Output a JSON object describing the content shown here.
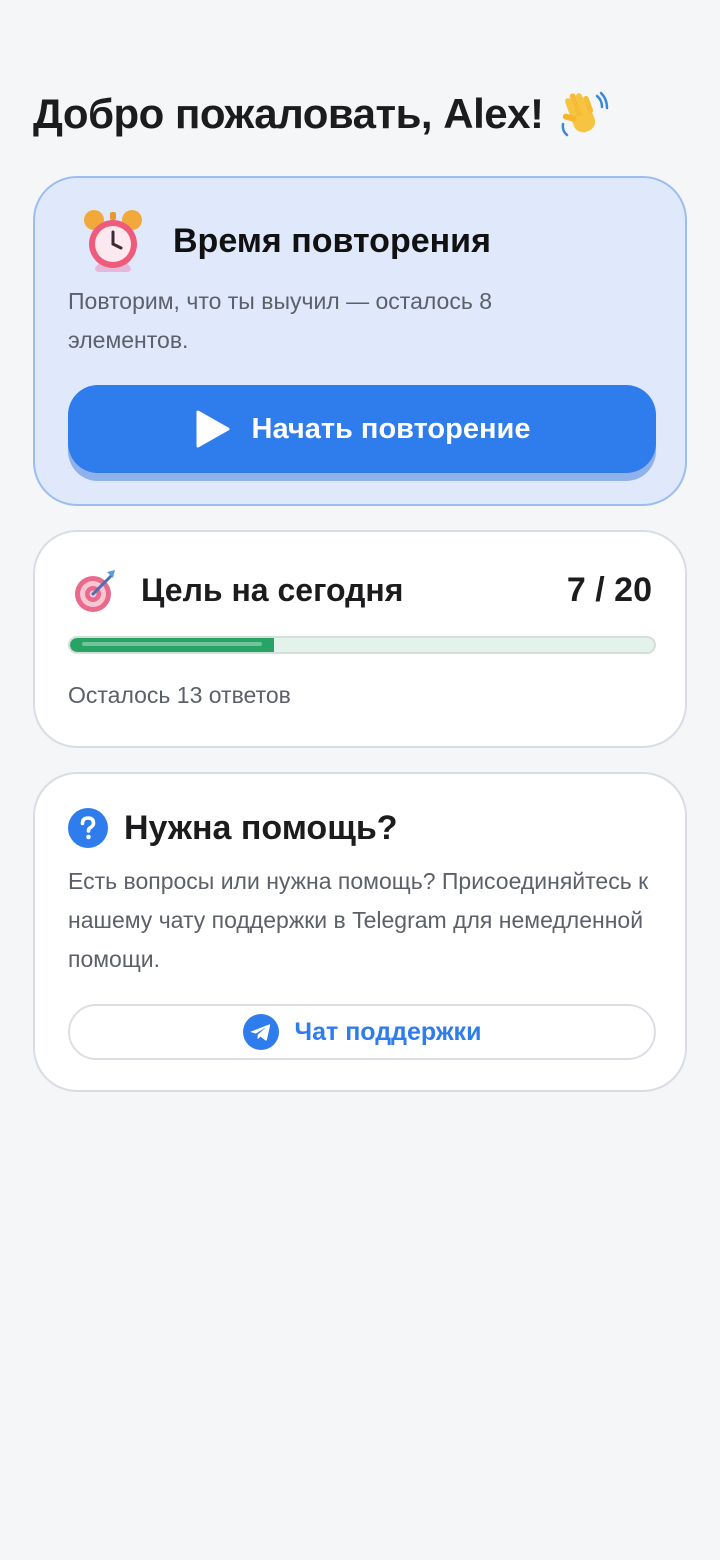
{
  "greeting": {
    "text": "Добро пожаловать, Alex!",
    "icon": "waving-hand-icon"
  },
  "review_card": {
    "icon": "alarm-clock-icon",
    "title": "Время повторения",
    "description": "Повторим, что ты выучил — осталось 8 элементов.",
    "button_label": "Начать повторение",
    "button_icon": "play-icon"
  },
  "goal_card": {
    "icon": "target-icon",
    "title": "Цель на сегодня",
    "count": "7 / 20",
    "progress_fraction": 0.35,
    "remaining": "Осталось 13 ответов"
  },
  "help_card": {
    "icon": "question-icon",
    "title": "Нужна помощь?",
    "description": "Есть вопросы или нужна помощь? Присоединяйтесь к нашему чату поддержки в Telegram для немедленной помощи.",
    "button_label": "Чат поддержки",
    "button_icon": "telegram-icon"
  },
  "colors": {
    "accent": "#2f7cec",
    "progress": "#27a464",
    "review_bg": "#dfe9fb",
    "page_bg": "#f5f6f8"
  }
}
